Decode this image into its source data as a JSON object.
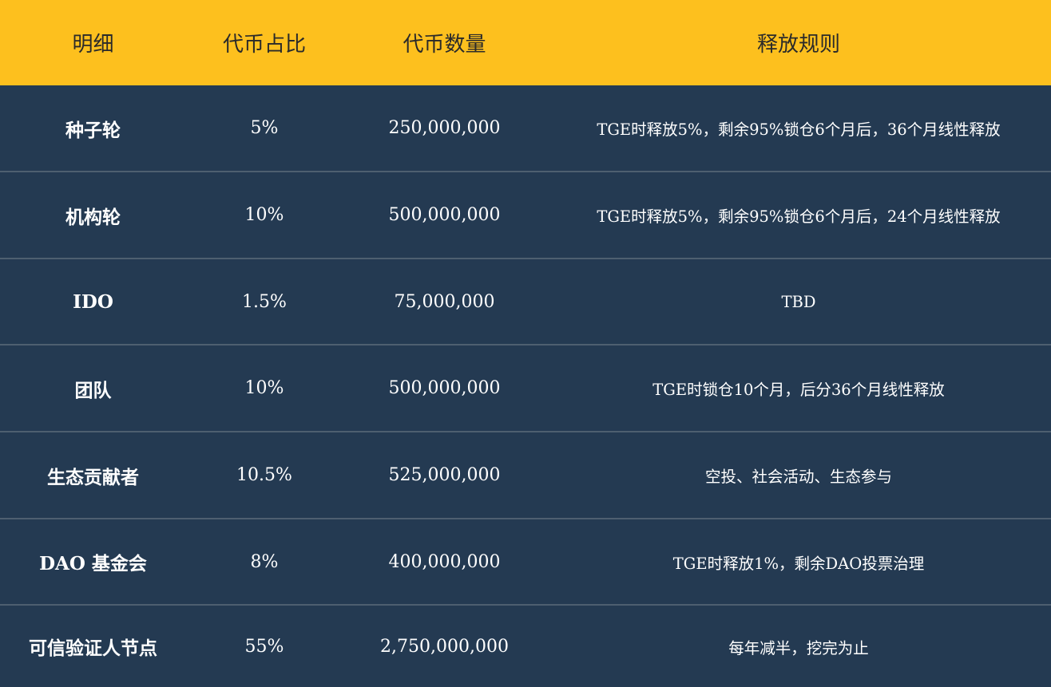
{
  "table": {
    "headers": [
      "明细",
      "代币占比",
      "代币数量",
      "释放规则"
    ],
    "rows": [
      [
        "种子轮",
        "5%",
        "250,000,000",
        "TGE时释放5%，剩余95%锁仓6个月后，36个月线性释放"
      ],
      [
        "机构轮",
        "10%",
        "500,000,000",
        "TGE时释放5%，剩余95%锁仓6个月后，24个月线性释放"
      ],
      [
        "IDO",
        "1.5%",
        "75,000,000",
        "TBD"
      ],
      [
        "团队",
        "10%",
        "500,000,000",
        "TGE时锁仓10个月，后分36个月线性释放"
      ],
      [
        "生态贡献者",
        "10.5%",
        "525,000,000",
        "空投、社会活动、生态参与"
      ],
      [
        "DAO 基金会",
        "8%",
        "400,000,000",
        "TGE时释放1%，剩余DAO投票治理"
      ],
      [
        "可信验证人节点",
        "55%",
        "2,750,000,000",
        "每年减半，挖完为止"
      ]
    ]
  },
  "colors": {
    "header_bg": "#fdc01e",
    "body_bg": "#243a52",
    "divider": "#4e5f70"
  }
}
